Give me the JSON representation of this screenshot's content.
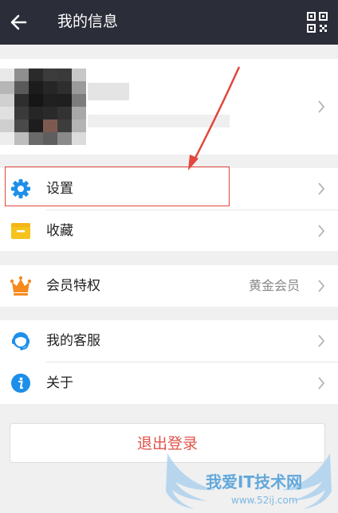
{
  "header": {
    "title": "我的信息",
    "back_icon": "arrow-left-icon",
    "qr_icon": "qr-code-icon",
    "background": "#2b2d38"
  },
  "menu": {
    "settings_label": "设置",
    "favorites_label": "收藏",
    "membership_label": "会员特权",
    "membership_value": "黄金会员",
    "customer_service_label": "我的客服",
    "about_label": "关于"
  },
  "logout": {
    "label": "退出登录",
    "color": "#e25349"
  },
  "watermark": {
    "text": "我爱IT技术网",
    "sub": "www.52ij.com"
  },
  "colors": {
    "accent_blue": "#1c8fea",
    "favorites_yellow": "#f6c31c",
    "crown_orange": "#f58a1f",
    "annotation_red": "#e2463c"
  }
}
